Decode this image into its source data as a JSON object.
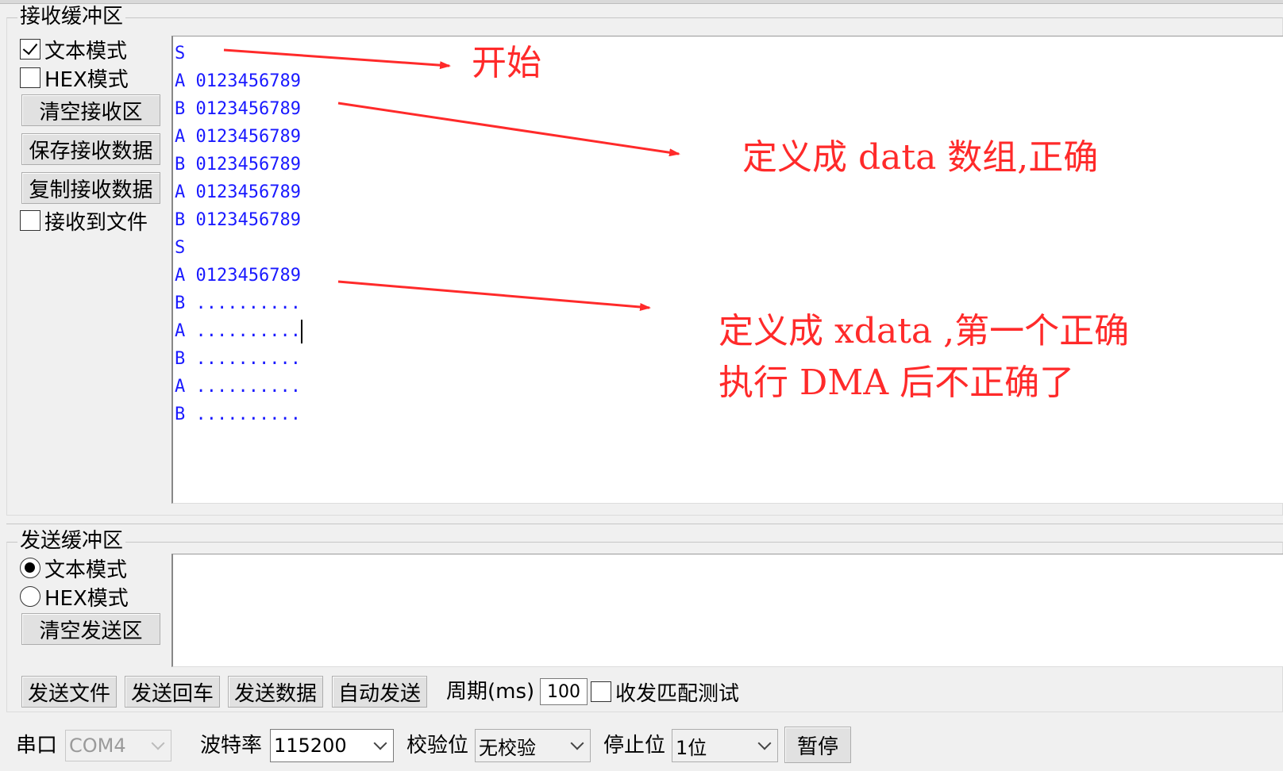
{
  "receive": {
    "title": "接收缓冲区",
    "text_mode": "文本模式",
    "hex_mode": "HEX模式",
    "clear_button": "清空接收区",
    "save_button": "保存接收数据",
    "copy_button": "复制接收数据",
    "to_file": "接收到文件",
    "lines": [
      "S",
      "A 0123456789",
      "B 0123456789",
      "A 0123456789",
      "B 0123456789",
      "A 0123456789",
      "B 0123456789",
      "S",
      "A 0123456789",
      "B ..........",
      "A ..........",
      "B ..........",
      "A ..........",
      "B .........."
    ]
  },
  "annotations": {
    "start": "开始",
    "data_correct": "定义成 data 数组,正确",
    "xdata_line1": "定义成 xdata ,第一个正确",
    "xdata_line2": "执行 DMA 后不正确了",
    "color": "#ff2a2a"
  },
  "send": {
    "title": "发送缓冲区",
    "text_mode": "文本模式",
    "hex_mode": "HEX模式",
    "clear_button": "清空发送区",
    "send_file": "发送文件",
    "send_enter": "发送回车",
    "send_data": "发送数据",
    "auto_send": "自动发送",
    "period_label": "周期(ms)",
    "period_value": "100",
    "match_test": "收发匹配测试"
  },
  "port": {
    "port_label": "串口",
    "port_value": "COM4",
    "baud_label": "波特率",
    "baud_value": "115200",
    "parity_label": "校验位",
    "parity_value": "无校验",
    "stop_label": "停止位",
    "stop_value": "1位",
    "pause_button": "暂停"
  },
  "colors": {
    "rx_text": "#1a1aff",
    "window_bg": "#f0f0f0"
  }
}
